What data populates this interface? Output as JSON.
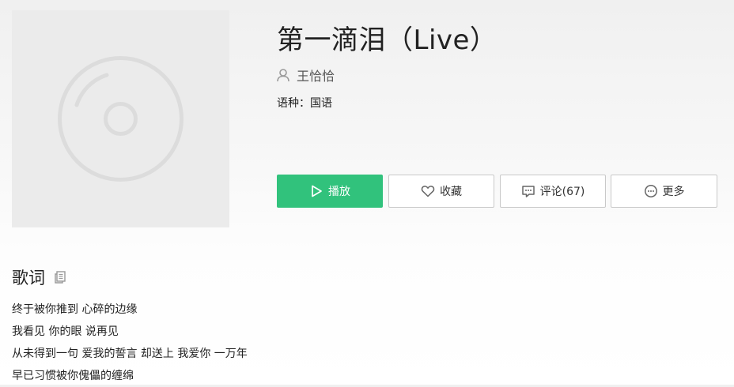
{
  "song": {
    "title": "第一滴泪（Live）",
    "singer": "王恰恰",
    "language_label": "语种：国语"
  },
  "actions": {
    "play": "播放",
    "favorite": "收藏",
    "comment": "评论(67)",
    "more": "更多"
  },
  "lyrics": {
    "heading": "歌词",
    "lines": [
      "终于被你推到 心碎的边缘",
      "我看见 你的眼 说再见",
      "从未得到一句 爱我的誓言 却送上 我爱你 一万年",
      "早已习惯被你傀儡的缠绵"
    ]
  },
  "icons": {
    "cover": "disc-placeholder-icon",
    "singer": "user-icon",
    "play": "play-icon",
    "favorite": "heart-icon",
    "comment": "comment-icon",
    "more": "more-icon",
    "copy": "copy-icon"
  },
  "colors": {
    "accent": "#31c27c",
    "text": "#222222",
    "border": "#c9c9c9",
    "cover_bg": "#ebebeb",
    "cover_ring": "#dcdcdc"
  }
}
